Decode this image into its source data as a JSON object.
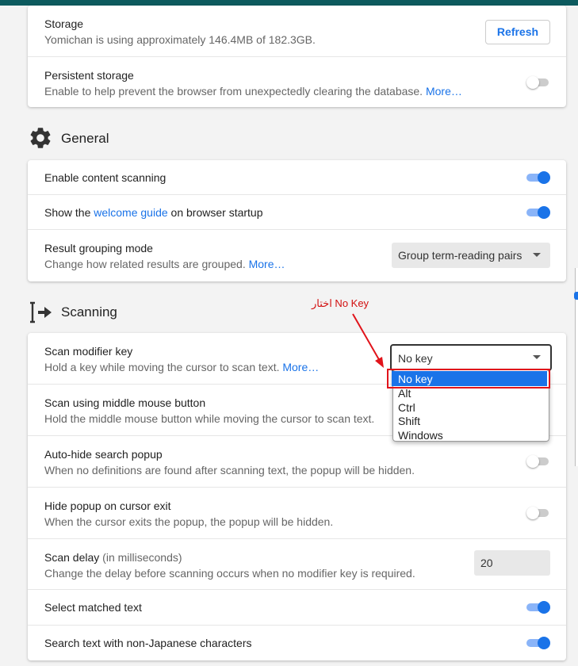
{
  "storage_card": {
    "storage": {
      "title": "Storage",
      "description": "Yomichan is using approximately 146.4MB of 182.3GB.",
      "button": "Refresh"
    },
    "persistent": {
      "title": "Persistent storage",
      "description": "Enable to help prevent the browser from unexpectedly clearing the database.",
      "more": "More…",
      "enabled": false
    }
  },
  "general": {
    "heading": "General",
    "icon": "gear-icon",
    "content_scanning": {
      "title": "Enable content scanning",
      "enabled": true
    },
    "welcome": {
      "prefix": "Show the",
      "link": "welcome guide",
      "suffix": "on browser startup",
      "enabled": true
    },
    "grouping": {
      "title": "Result grouping mode",
      "description": "Change how related results are grouped.",
      "more": "More…",
      "selected": "Group term-reading pairs"
    }
  },
  "scanning": {
    "heading": "Scanning",
    "icon": "text-cursor-arrow-icon",
    "modifier": {
      "title": "Scan modifier key",
      "description": "Hold a key while moving the cursor to scan text.",
      "more": "More…",
      "selected": "No key",
      "options": [
        "No key",
        "Alt",
        "Ctrl",
        "Shift",
        "Windows"
      ]
    },
    "middle_mouse": {
      "title": "Scan using middle mouse button",
      "description": "Hold the middle mouse button while moving the cursor to scan text."
    },
    "auto_hide": {
      "title": "Auto-hide search popup",
      "description": "When no definitions are found after scanning text, the popup will be hidden.",
      "enabled": false
    },
    "hide_on_exit": {
      "title": "Hide popup on cursor exit",
      "description": "When the cursor exits the popup, the popup will be hidden.",
      "enabled": false
    },
    "delay": {
      "title": "Scan delay",
      "unit": "(in milliseconds)",
      "description": "Change the delay before scanning occurs when no modifier key is required.",
      "value": "20"
    },
    "select_matched": {
      "title": "Select matched text",
      "enabled": true
    },
    "non_japanese": {
      "title": "Search text with non-Japanese characters",
      "enabled": true
    }
  },
  "annotation": {
    "text": "اختار No Key",
    "color": "#e1141b"
  },
  "colors": {
    "accent": "#1a73e8",
    "topbar": "#0c5a5e"
  }
}
